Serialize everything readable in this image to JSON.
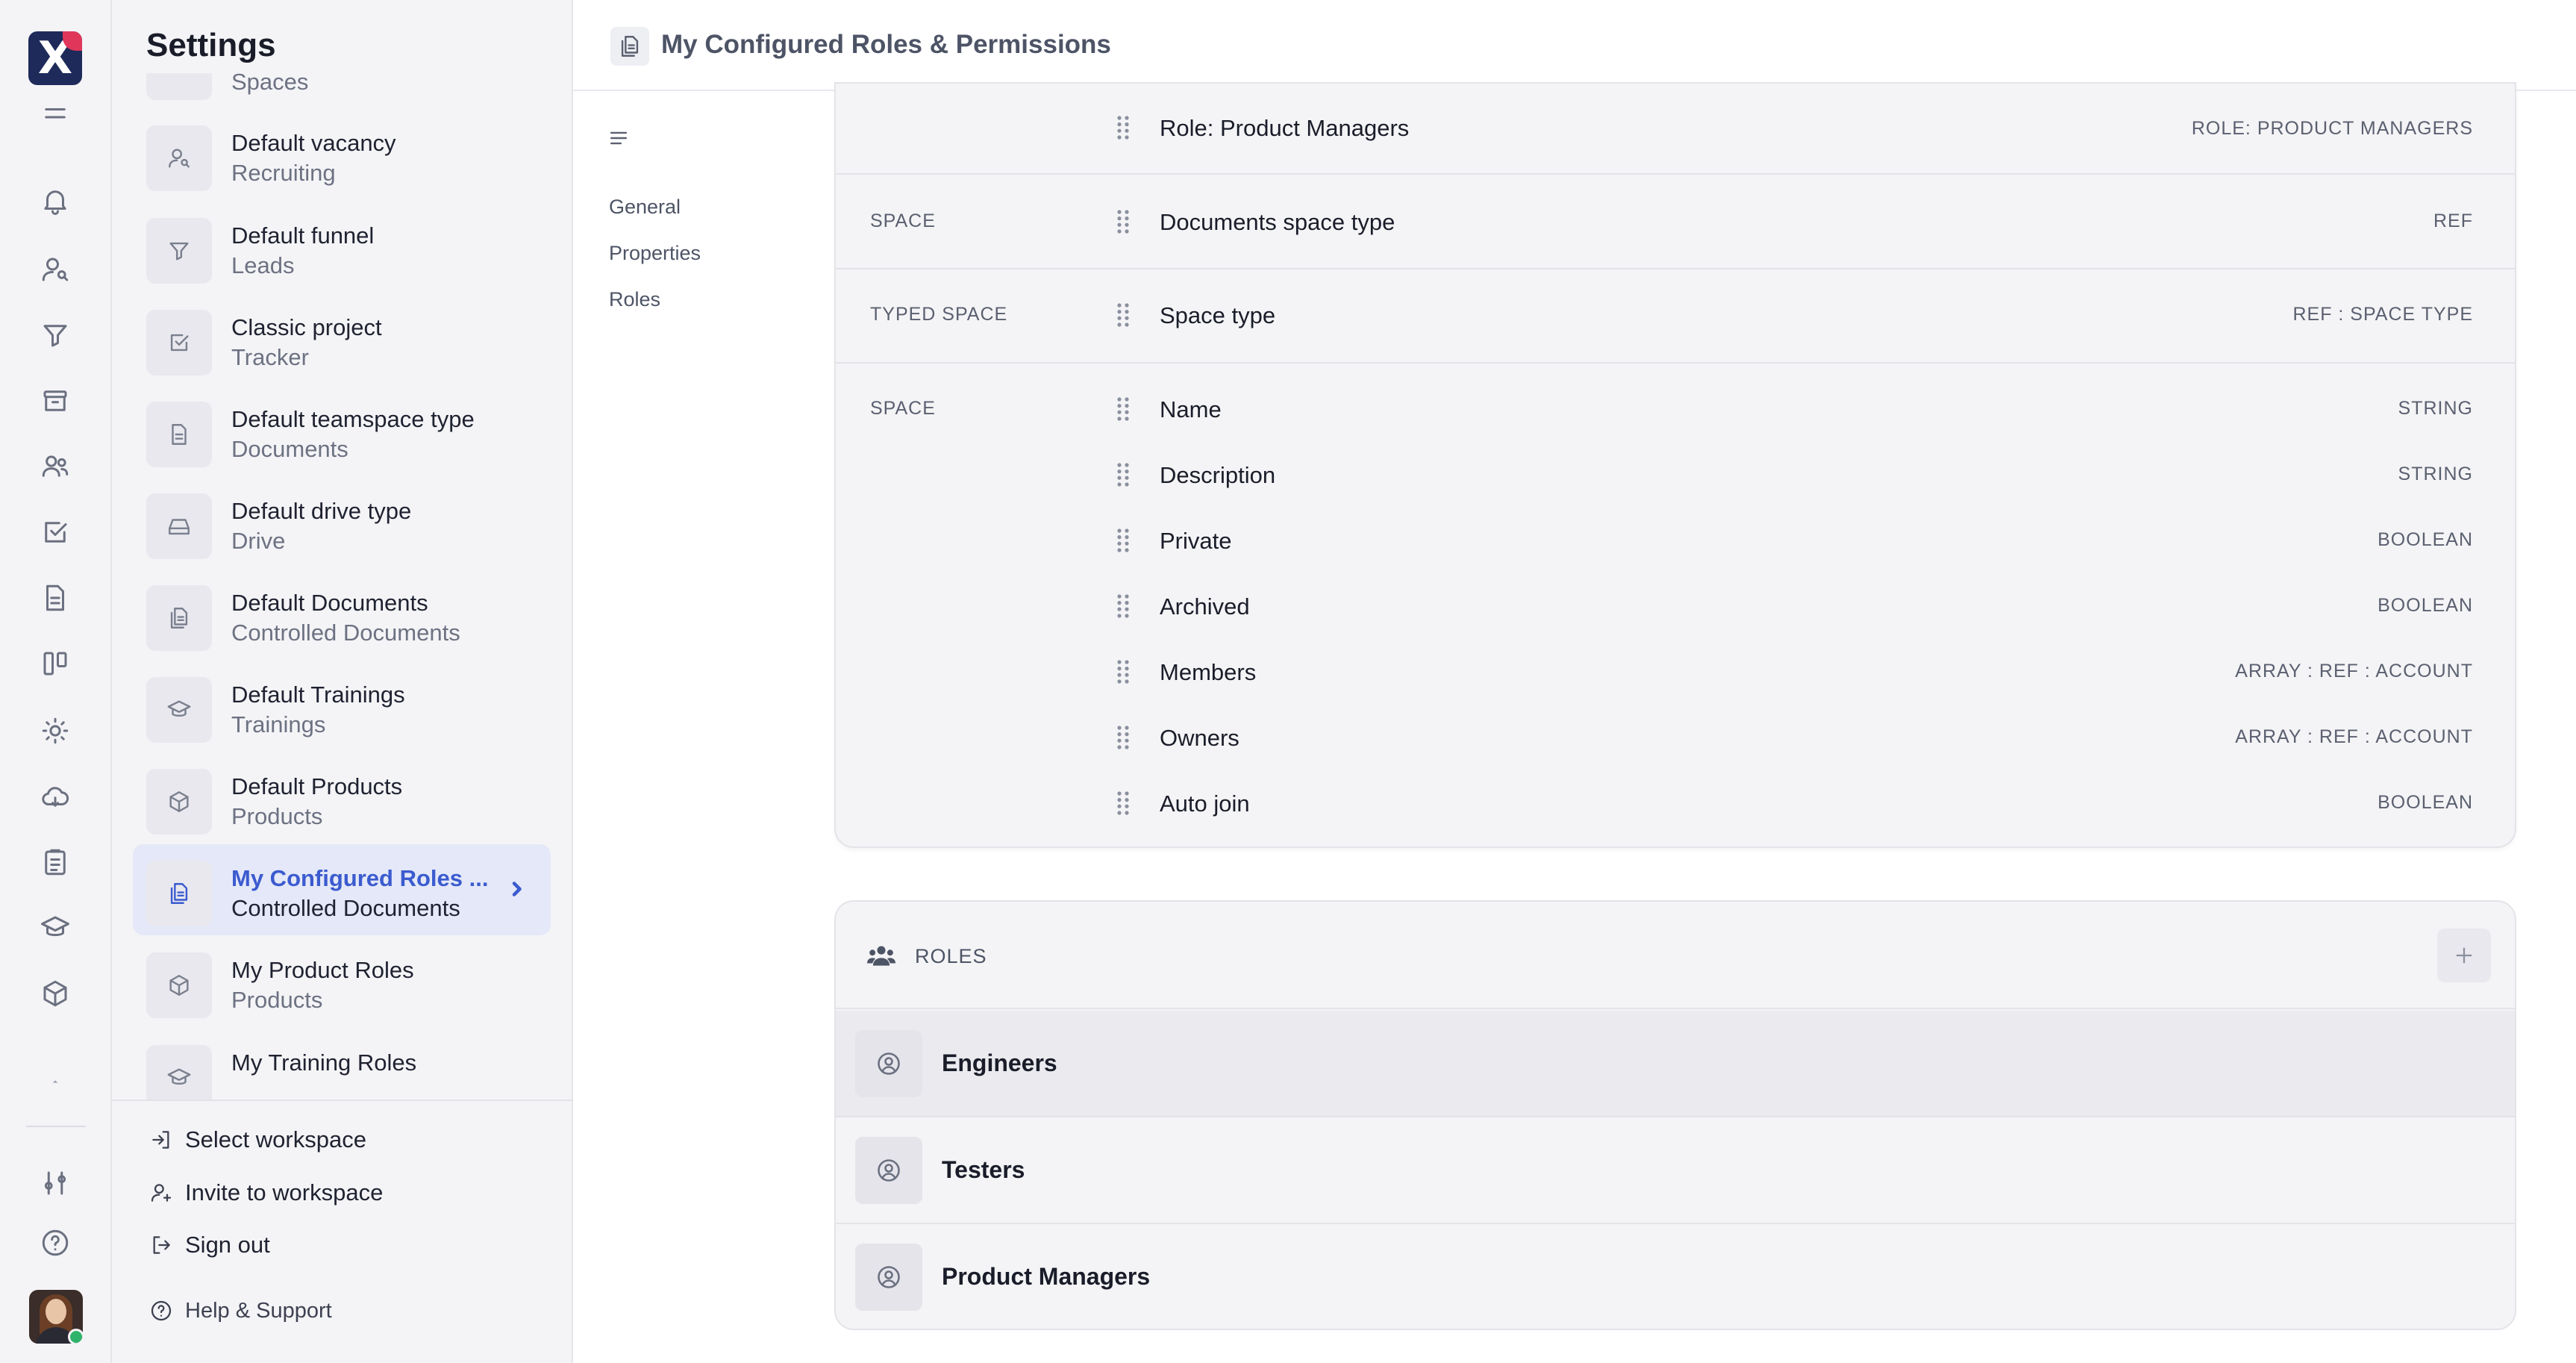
{
  "app": {
    "brand_colors": {
      "logo_bg": "#1e2a5a",
      "accent": "#3b5bcf",
      "online": "#2fb36a"
    }
  },
  "rail": {
    "icons": [
      "logo-icon",
      "menu-icon",
      "bell-icon",
      "user-search-icon",
      "funnel-icon",
      "archive-icon",
      "team-icon",
      "checkbox-icon",
      "document-icon",
      "board-icon",
      "sun-icon",
      "cloud-icon",
      "clipboard-icon",
      "graduation-cap-icon",
      "cube-icon",
      "chevron-up-icon",
      "sliders-icon",
      "help-icon",
      "avatar"
    ]
  },
  "settings": {
    "title": "Settings",
    "items": [
      {
        "name": "",
        "sub": "Spaces",
        "icon": "space-icon"
      },
      {
        "name": "Default vacancy",
        "sub": "Recruiting",
        "icon": "user-search-icon"
      },
      {
        "name": "Default funnel",
        "sub": "Leads",
        "icon": "funnel-icon"
      },
      {
        "name": "Classic project",
        "sub": "Tracker",
        "icon": "checkbox-icon"
      },
      {
        "name": "Default teamspace type",
        "sub": "Documents",
        "icon": "document-icon"
      },
      {
        "name": "Default drive type",
        "sub": "Drive",
        "icon": "drive-icon"
      },
      {
        "name": "Default Documents",
        "sub": "Controlled Documents",
        "icon": "controlled-doc-icon"
      },
      {
        "name": "Default Trainings",
        "sub": "Trainings",
        "icon": "graduation-cap-icon"
      },
      {
        "name": "Default Products",
        "sub": "Products",
        "icon": "cube-icon"
      },
      {
        "name": "My Configured Roles ...",
        "sub": "Controlled Documents",
        "icon": "controlled-doc-icon",
        "active": true
      },
      {
        "name": "My Product Roles",
        "sub": "Products",
        "icon": "cube-icon"
      },
      {
        "name": "My Training Roles",
        "sub": "",
        "icon": "graduation-cap-icon"
      }
    ],
    "footer": {
      "select_workspace": "Select workspace",
      "invite": "Invite to workspace",
      "sign_out": "Sign out",
      "help": "Help & Support"
    }
  },
  "header": {
    "title": "My Configured Roles & Permissions"
  },
  "subnav": {
    "items": [
      "General",
      "Properties",
      "Roles"
    ]
  },
  "properties": {
    "rows": [
      {
        "group": "",
        "name": "Role: Product Managers",
        "type": "ROLE: PRODUCT MANAGERS"
      },
      {
        "group": "SPACE",
        "name": "Documents space type",
        "type": "REF"
      },
      {
        "group": "TYPED SPACE",
        "name": "Space type",
        "type": "REF : SPACE TYPE"
      },
      {
        "group": "SPACE",
        "name": "Name",
        "type": "STRING"
      },
      {
        "group": "",
        "name": "Description",
        "type": "STRING"
      },
      {
        "group": "",
        "name": "Private",
        "type": "BOOLEAN"
      },
      {
        "group": "",
        "name": "Archived",
        "type": "BOOLEAN"
      },
      {
        "group": "",
        "name": "Members",
        "type": "ARRAY : REF : ACCOUNT"
      },
      {
        "group": "",
        "name": "Owners",
        "type": "ARRAY : REF : ACCOUNT"
      },
      {
        "group": "",
        "name": "Auto join",
        "type": "BOOLEAN"
      }
    ]
  },
  "roles": {
    "label": "ROLES",
    "items": [
      "Engineers",
      "Testers",
      "Product Managers"
    ]
  }
}
